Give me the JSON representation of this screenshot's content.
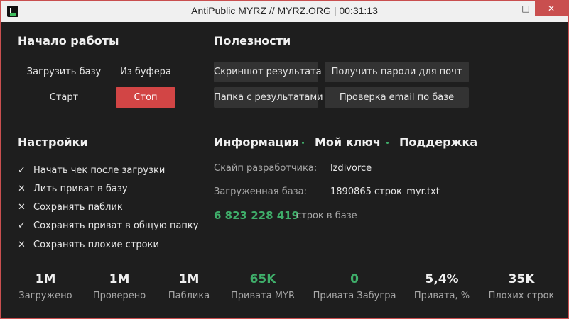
{
  "window": {
    "title": "AntiPublic MYRZ // MYRZ.ORG | 00:31:13",
    "controls": {
      "minimize": "—",
      "maximize": "□",
      "close": "✕"
    }
  },
  "start": {
    "heading": "Начало работы",
    "load_db": "Загрузить базу",
    "from_clipboard": "Из буфера",
    "start": "Старт",
    "stop": "Стоп"
  },
  "tools": {
    "heading": "Полезности",
    "screenshot": "Скриншот результата",
    "get_passwords": "Получить пароли для почт",
    "results_folder": "Папка с результатами",
    "check_email": "Проверка email по базе"
  },
  "settings": {
    "heading": "Настройки",
    "items": [
      {
        "label": "Начать чек после загрузки",
        "checked": true,
        "mark": "✓"
      },
      {
        "label": "Лить приват в базу",
        "checked": false,
        "mark": "✕"
      },
      {
        "label": "Сохранять паблик",
        "checked": false,
        "mark": "✕"
      },
      {
        "label": "Сохранять приват в общую папку",
        "checked": true,
        "mark": "✓"
      },
      {
        "label": "Сохранять плохие строки",
        "checked": false,
        "mark": "✕"
      }
    ]
  },
  "info": {
    "tab_info": "Информация",
    "tab_key": "Мой ключ",
    "tab_support": "Поддержка",
    "dev_skype_label": "Скайп разработчика:",
    "dev_skype_value": "lzdivorce",
    "loaded_db_label": "Загруженная база:",
    "loaded_db_value": "1890865 строк_myr.txt",
    "rows_count": "6 823 228 419",
    "rows_label": "строк в базе"
  },
  "stats": [
    {
      "value": "1M",
      "label": "Загружено",
      "green": false
    },
    {
      "value": "1M",
      "label": "Проверено",
      "green": false
    },
    {
      "value": "1M",
      "label": "Паблика",
      "green": false
    },
    {
      "value": "65K",
      "label": "Привата MYR",
      "green": true
    },
    {
      "value": "0",
      "label": "Привата Забугра",
      "green": true
    },
    {
      "value": "5,4%",
      "label": "Привата, %",
      "green": false
    },
    {
      "value": "35K",
      "label": "Плохих строк",
      "green": false
    }
  ],
  "colors": {
    "accent_green": "#3fae6a",
    "stop_red": "#d24545",
    "background": "#1e1e1e"
  }
}
